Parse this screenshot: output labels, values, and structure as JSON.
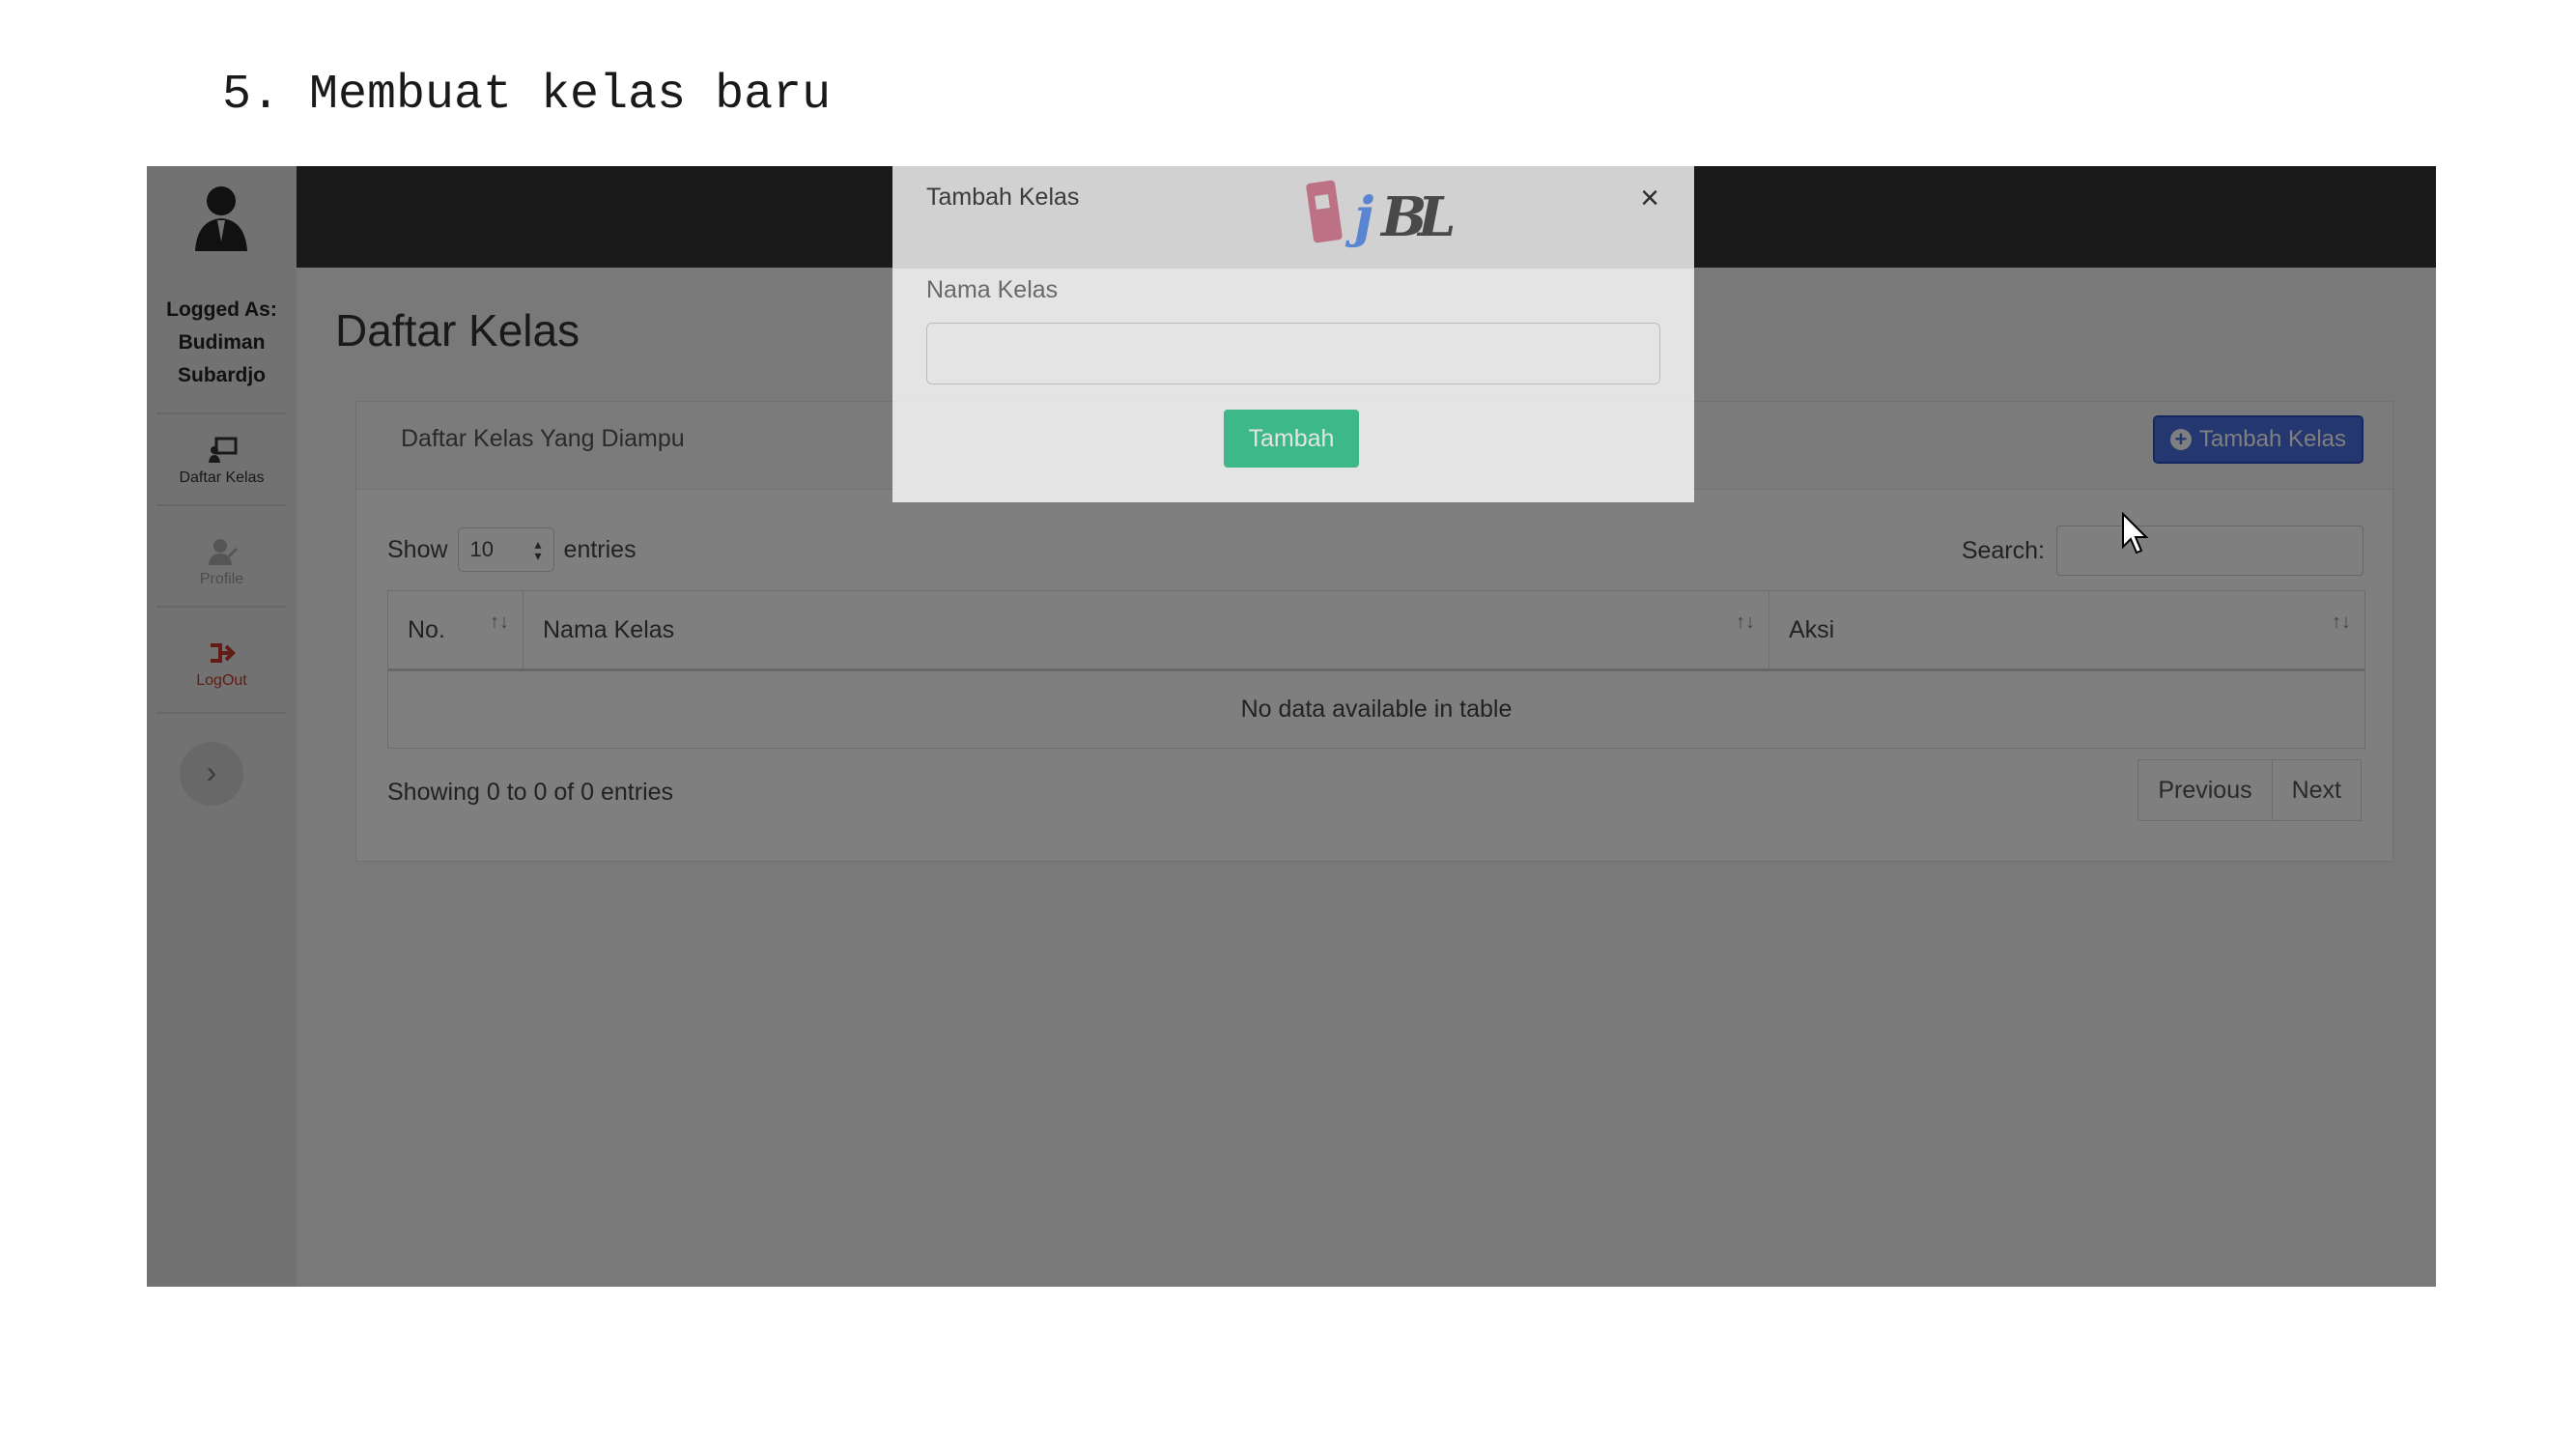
{
  "caption": "5. Membuat kelas baru",
  "sidebar": {
    "logged_as_label": "Logged As:",
    "user_first": "Budiman",
    "user_last": "Subardjo",
    "items": [
      {
        "label": "Daftar Kelas",
        "icon": "class-icon"
      },
      {
        "label": "Profile",
        "icon": "user-icon"
      },
      {
        "label": "LogOut",
        "icon": "logout-icon",
        "color": "#c0392b"
      }
    ],
    "toggle_glyph": "›"
  },
  "main": {
    "page_title": "Daftar Kelas",
    "card_title": "Daftar Kelas Yang Diampu",
    "add_button_label": "Tambah Kelas",
    "show_label": "Show",
    "entries_label": "entries",
    "page_length": "10",
    "search_label": "Search:",
    "table": {
      "columns": [
        "No.",
        "Nama Kelas",
        "Aksi"
      ],
      "empty_message": "No data available in table"
    },
    "info_text": "Showing 0 to 0 of 0 entries",
    "pagination": {
      "previous": "Previous",
      "next": "Next"
    }
  },
  "modal": {
    "title": "Tambah Kelas",
    "close_glyph": "×",
    "field_label": "Nama Kelas",
    "field_value": "",
    "submit_label": "Tambah",
    "logo_text": "PjBL"
  },
  "colors": {
    "topbar": "#333333",
    "primary_button": "#4b6fe0",
    "success_button": "#2ec88c",
    "logout": "#c0392b"
  }
}
